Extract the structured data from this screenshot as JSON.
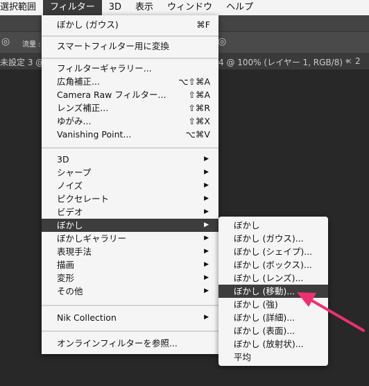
{
  "menubar": [
    "選択範囲",
    "フィルター",
    "3D",
    "表示",
    "ウィンドウ",
    "ヘルプ"
  ],
  "options_bar": {
    "flow_label": "流量 :"
  },
  "tabs": {
    "left": "未設定 3 @ 1",
    "right": "4 @ 100% (レイヤー 1, RGB/8) *",
    "close": "×",
    "next": "2"
  },
  "filter_menu": [
    {
      "label": "ぼかし (ガウス)",
      "shortcut": "⌘F"
    },
    {
      "sep": 12
    },
    {
      "label": "スマートフィルター用に変換"
    },
    {
      "sep": 13
    },
    {
      "label": "フィルターギャラリー..."
    },
    {
      "label": "広角補正...",
      "shortcut": "⌥⇧⌘A"
    },
    {
      "label": "Camera Raw フィルター...",
      "shortcut": "⇧⌘A"
    },
    {
      "label": "レンズ補正...",
      "shortcut": "⇧⌘R"
    },
    {
      "label": "ゆがみ...",
      "shortcut": "⇧⌘X"
    },
    {
      "label": "Vanishing Point...",
      "shortcut": "⌥⌘V"
    },
    {
      "sep": 17
    },
    {
      "label": "3D",
      "submenu": true
    },
    {
      "label": "シャープ",
      "submenu": true
    },
    {
      "label": "ノイズ",
      "submenu": true
    },
    {
      "label": "ピクセレート",
      "submenu": true
    },
    {
      "label": "ビデオ",
      "submenu": true
    },
    {
      "label": "ぼかし",
      "submenu": true,
      "highlighted": true
    },
    {
      "label": "ぼかしギャラリー",
      "submenu": true
    },
    {
      "label": "表現手法",
      "submenu": true
    },
    {
      "label": "描画",
      "submenu": true
    },
    {
      "label": "変形",
      "submenu": true
    },
    {
      "label": "その他",
      "submenu": true
    },
    {
      "sep": 19
    },
    {
      "label": "Nik Collection",
      "submenu": true
    },
    {
      "sep": 18
    },
    {
      "label": "オンラインフィルターを参照..."
    }
  ],
  "blur_submenu": [
    {
      "label": "ぼかし"
    },
    {
      "label": "ぼかし (ガウス)..."
    },
    {
      "label": "ぼかし (シェイプ)..."
    },
    {
      "label": "ぼかし (ボックス)..."
    },
    {
      "label": "ぼかし (レンズ)..."
    },
    {
      "label": "ぼかし (移動)...",
      "highlighted": true
    },
    {
      "label": "ぼかし (強)"
    },
    {
      "label": "ぼかし (詳細)..."
    },
    {
      "label": "ぼかし (表面)..."
    },
    {
      "label": "ぼかし (放射状)..."
    },
    {
      "label": "平均"
    }
  ],
  "colors": {
    "annotation_arrow": "#f0306e",
    "highlight": "#3d3d3d"
  }
}
